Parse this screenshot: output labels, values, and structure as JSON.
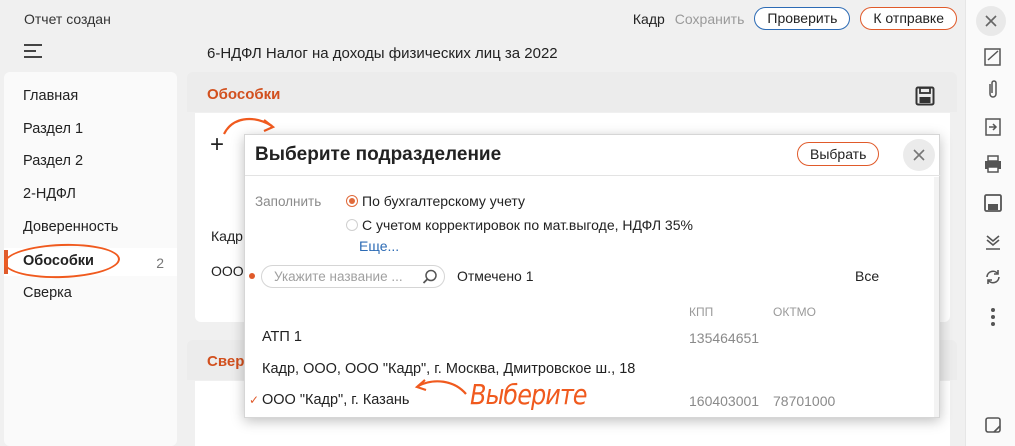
{
  "header": {
    "status": "Отчет создан",
    "form_title": "6-НДФЛ Налог на доходы физических лиц за 2022",
    "actions": {
      "kadr": "Кадр",
      "save": "Сохранить",
      "check": "Проверить",
      "send": "К отправке"
    }
  },
  "sidebar": {
    "items": [
      {
        "label": "Главная"
      },
      {
        "label": "Раздел 1"
      },
      {
        "label": "Раздел 2"
      },
      {
        "label": "2-НДФЛ"
      },
      {
        "label": "Доверенность"
      },
      {
        "label": "Обособки",
        "count": "2",
        "active": true
      },
      {
        "label": "Сверка"
      }
    ]
  },
  "main": {
    "section_title": "Обособки",
    "section2_title": "Свер",
    "bg_row1": "Кадр",
    "bg_row2": "ООО"
  },
  "modal": {
    "title": "Выберите подразделение",
    "select_button": "Выбрать",
    "fill_label": "Заполнить",
    "radio_options": [
      {
        "label": "По бухгалтерскому учету",
        "checked": true
      },
      {
        "label": "С учетом корректировок по мат.выгоде, НДФЛ 35%",
        "checked": false
      }
    ],
    "more_link": "Еще...",
    "search_placeholder": "Укажите название ...",
    "marked": "Отмечено 1",
    "all": "Все",
    "columns": {
      "kpp": "КПП",
      "oktmo": "ОКТМО"
    },
    "rows": [
      {
        "name": "АТП 1",
        "kpp": "135464651",
        "oktmo": "",
        "checked": false
      },
      {
        "name": "Кадр, ООО, ООО \"Кадр\", г. Москва, Дмитровское ш., 18",
        "kpp": "",
        "oktmo": "",
        "checked": false
      },
      {
        "name": "ООО \"Кадр\", г. Казань",
        "kpp": "160403001",
        "oktmo": "78701000",
        "checked": true
      }
    ]
  },
  "annotation": {
    "handwritten": "Выберите"
  },
  "colors": {
    "accent": "#e05a2a",
    "link": "#2c6bb5",
    "annotation": "#f05a1e"
  }
}
